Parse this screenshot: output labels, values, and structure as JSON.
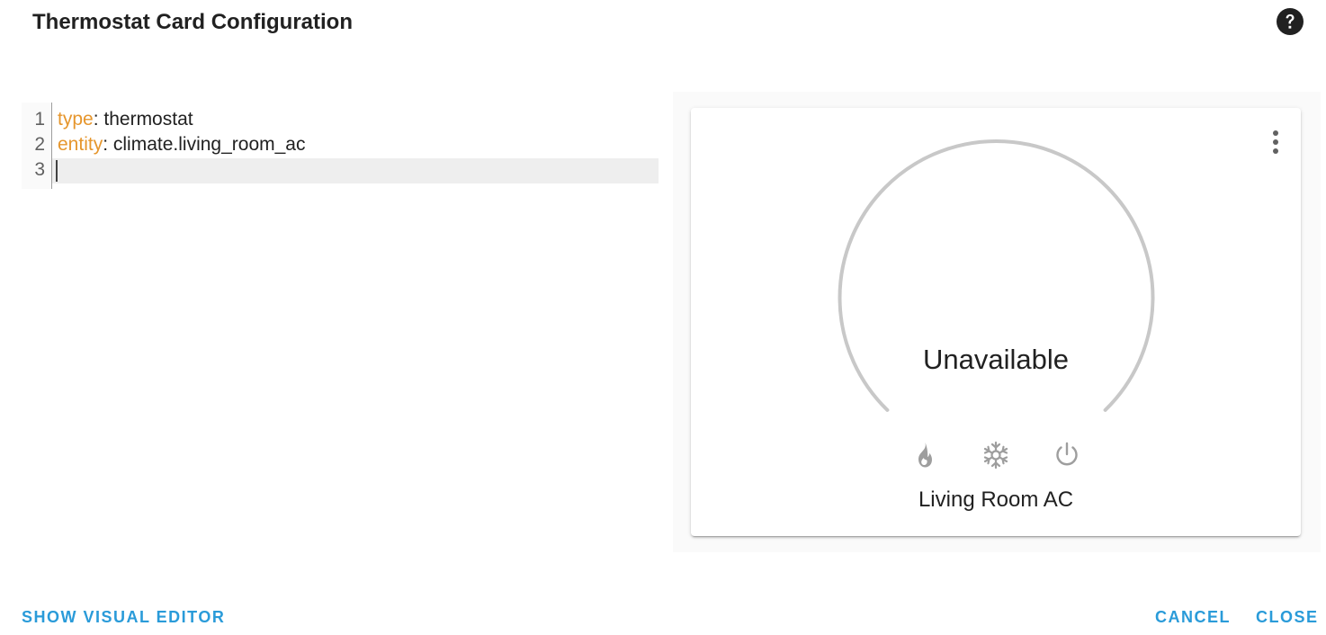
{
  "dialog": {
    "title": "Thermostat Card Configuration"
  },
  "editor": {
    "lines": [
      {
        "number": "1",
        "key": "type",
        "separator": ":",
        "value": " thermostat"
      },
      {
        "number": "2",
        "key": "entity",
        "separator": ":",
        "value": " climate.living_room_ac"
      },
      {
        "number": "3",
        "key": "",
        "separator": "",
        "value": ""
      }
    ]
  },
  "preview": {
    "state": "Unavailable",
    "entity_name": "Living Room AC",
    "modes": [
      "fire-icon",
      "snowflake-icon",
      "power-icon"
    ]
  },
  "footer": {
    "show_visual_editor": "SHOW VISUAL EDITOR",
    "cancel": "CANCEL",
    "close": "CLOSE"
  },
  "colors": {
    "accent": "#2a9bd9",
    "yaml_key": "#e6962d",
    "dial": "#c8c8c8",
    "mode_icon": "#9e9e9e"
  }
}
